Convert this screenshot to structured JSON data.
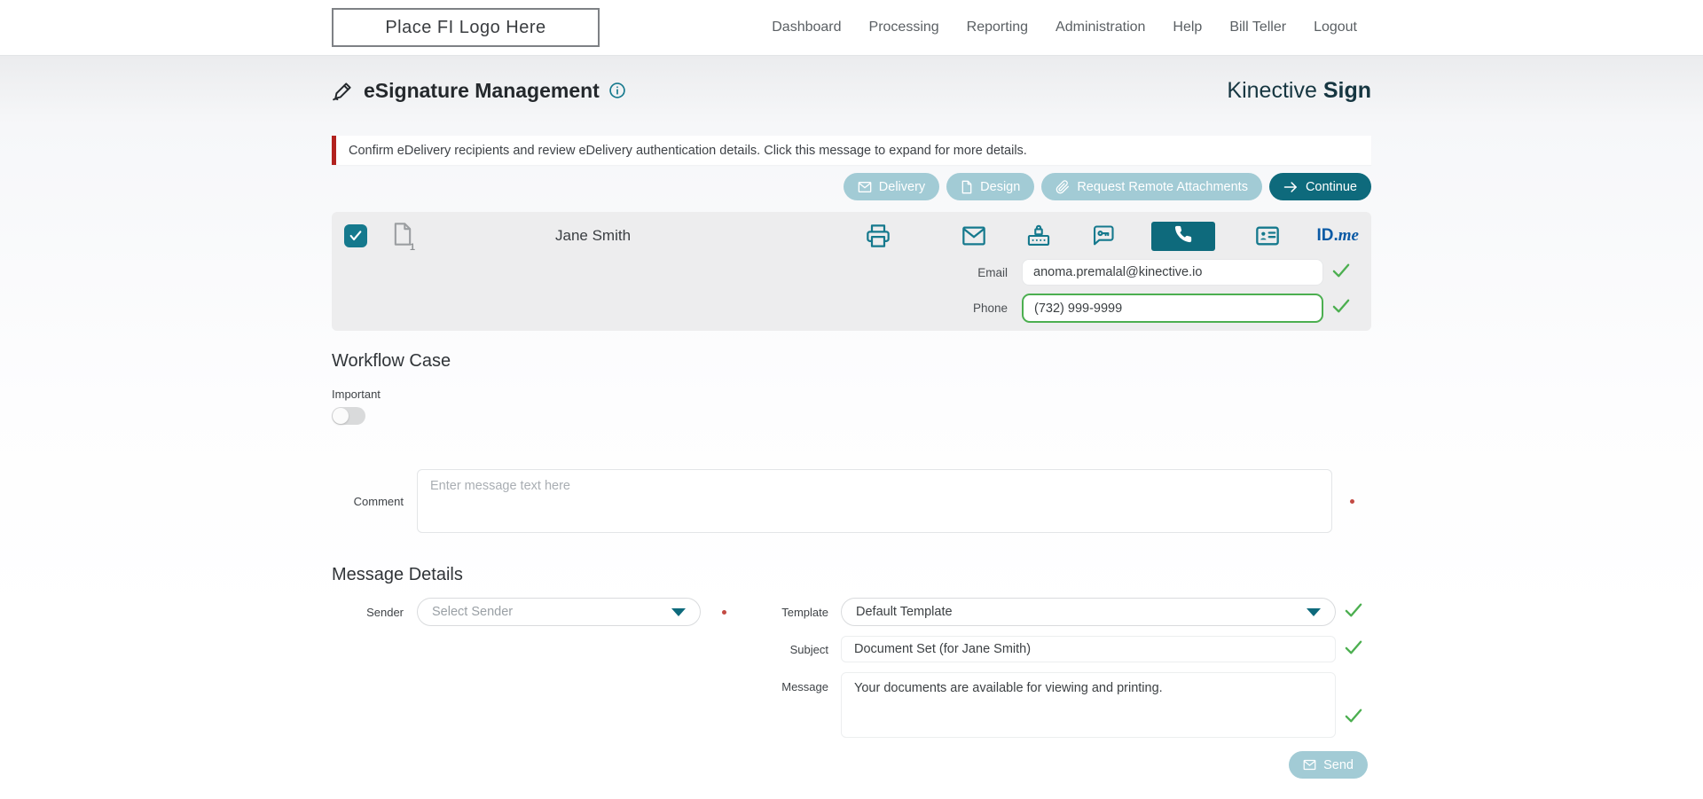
{
  "nav": {
    "logo_text": "Place FI Logo Here",
    "items": [
      "Dashboard",
      "Processing",
      "Reporting",
      "Administration",
      "Help",
      "Bill Teller",
      "Logout"
    ]
  },
  "header": {
    "title": "eSignature Management",
    "brand_name": "Kinective",
    "brand_suffix": "Sign"
  },
  "alert": {
    "text": "Confirm eDelivery recipients and review eDelivery authentication details. Click this message to expand for more details."
  },
  "toolbar": {
    "delivery_label": "Delivery",
    "design_label": "Design",
    "request_remote_label": "Request Remote Attachments",
    "continue_label": "Continue"
  },
  "recipient": {
    "name": "Jane Smith",
    "doc_count": "1",
    "email_label": "Email",
    "email_value": "anoma.premalal@kinective.io",
    "phone_label": "Phone",
    "phone_value": "(732) 999-9999",
    "idme_id": "ID.",
    "idme_me": "me"
  },
  "workflow": {
    "heading": "Workflow Case",
    "important_label": "Important",
    "comment_label": "Comment",
    "comment_placeholder": "Enter message text here"
  },
  "message_details": {
    "heading": "Message Details",
    "sender_label": "Sender",
    "sender_placeholder": "Select Sender",
    "template_label": "Template",
    "template_value": "Default Template",
    "subject_label": "Subject",
    "subject_value": "Document Set (for Jane Smith)",
    "message_label": "Message",
    "message_value": "Your documents are available for viewing and printing.",
    "send_label": "Send"
  },
  "icons": {
    "title": "signature-pen-icon",
    "info": "info-icon",
    "delivery_methods": [
      "printer-icon",
      "envelope-icon",
      "passcode-lock-icon",
      "sms-key-icon",
      "phone-icon",
      "id-card-icon",
      "idme-logo"
    ],
    "status": "green-check-icon",
    "required": "red-dot"
  },
  "colors": {
    "teal_dark": "#0e6a7c",
    "teal_light": "#a2cbd5",
    "teal_icon": "#15798d",
    "green_check": "#4caf50",
    "alert_red": "#b2221f",
    "idme_blue": "#0b5aa5",
    "brand_text": "#163641",
    "row_gray": "#ededee"
  }
}
